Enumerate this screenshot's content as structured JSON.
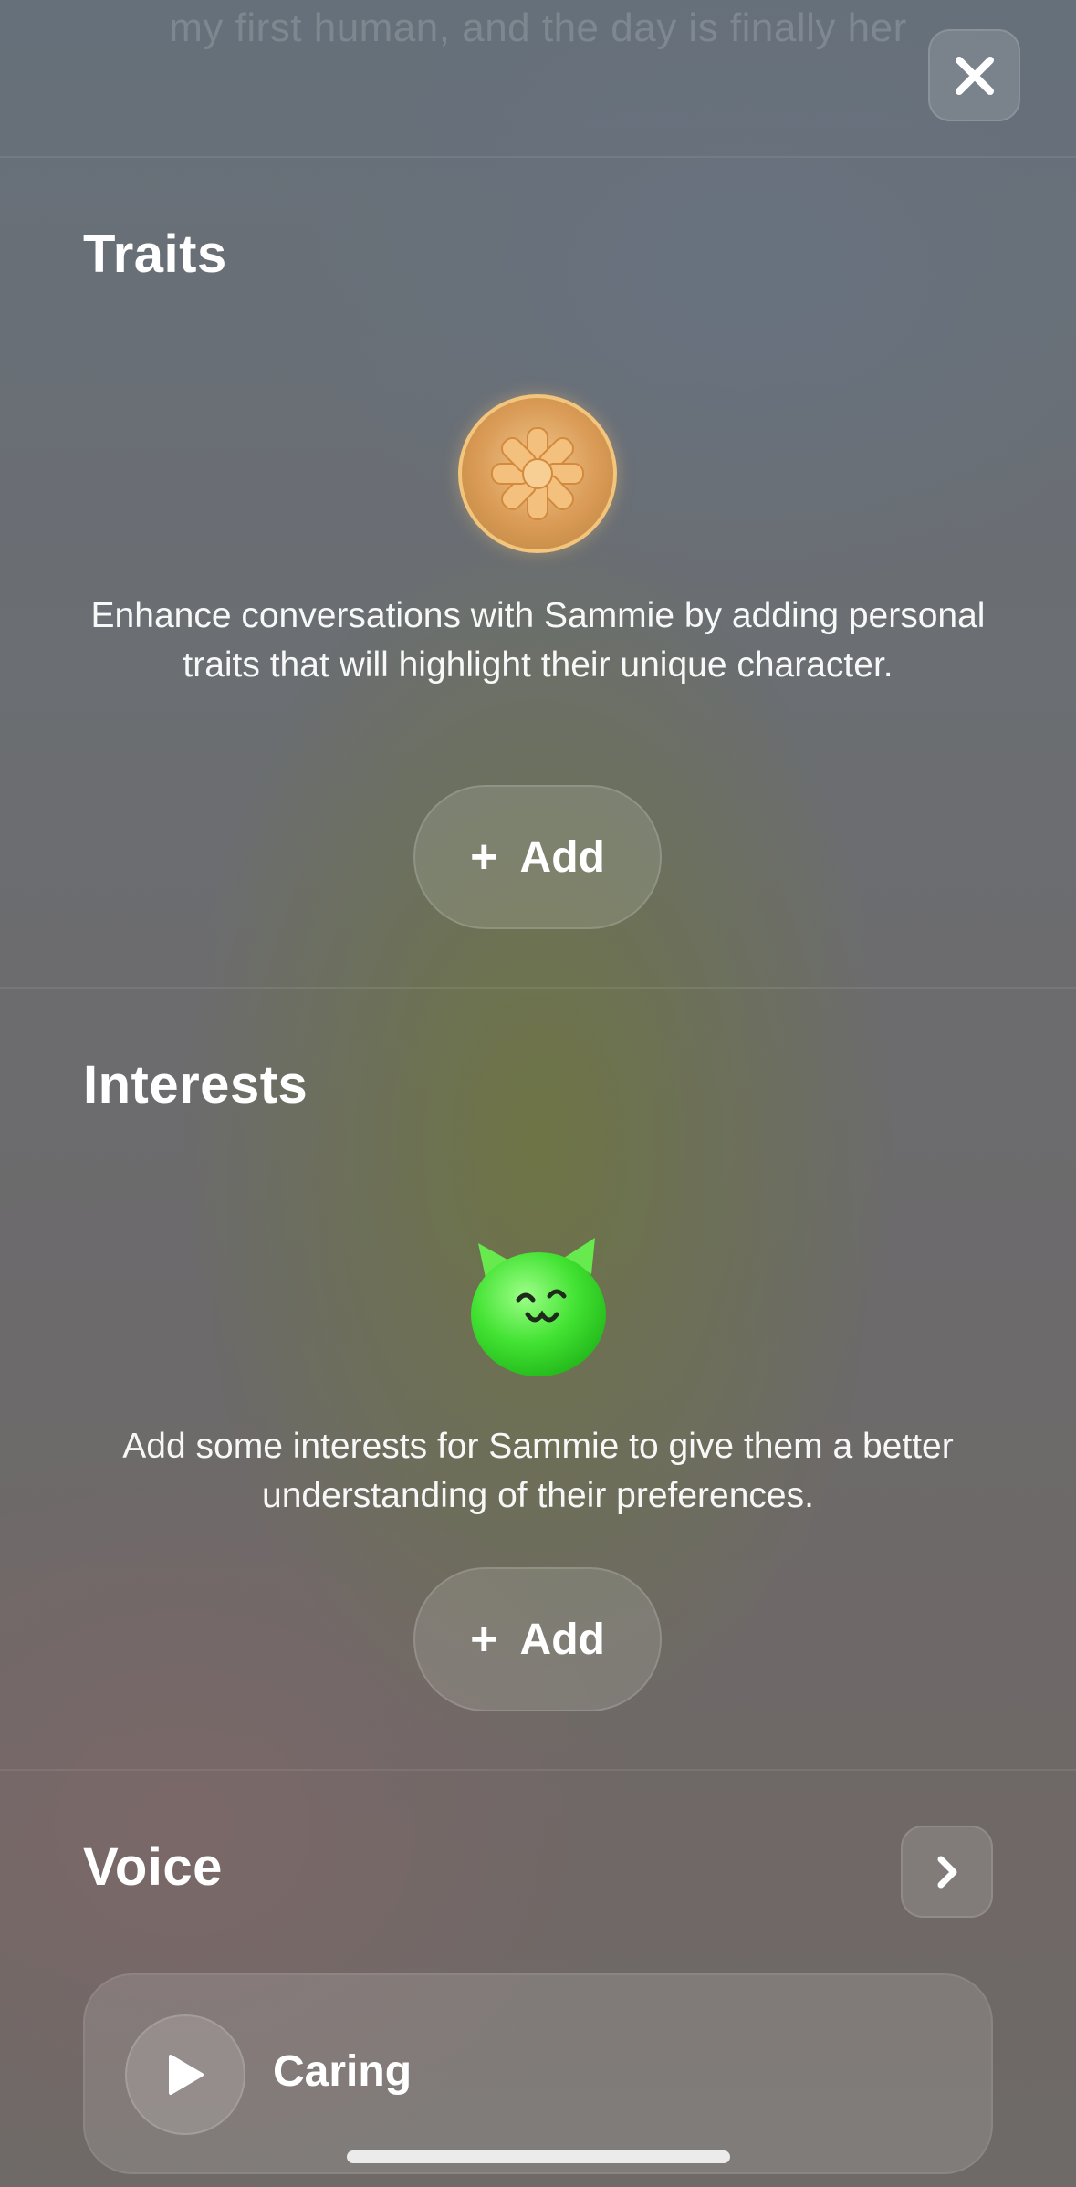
{
  "header": {
    "faded_text": "my first human, and the day is finally her"
  },
  "traits": {
    "title": "Traits",
    "description": "Enhance conversations with Sammie by adding personal traits that will highlight their unique character.",
    "add_label": "Add",
    "icon": "orange-flower-badge"
  },
  "interests": {
    "title": "Interests",
    "description": "Add some interests for Sammie to give them a better understanding of their preferences.",
    "add_label": "Add",
    "icon": "green-cat-blob"
  },
  "voice": {
    "title": "Voice",
    "selected_voice": "Caring"
  },
  "colors": {
    "accent_orange": "#e8b070",
    "accent_green": "#46e83a",
    "text": "#ffffff"
  }
}
